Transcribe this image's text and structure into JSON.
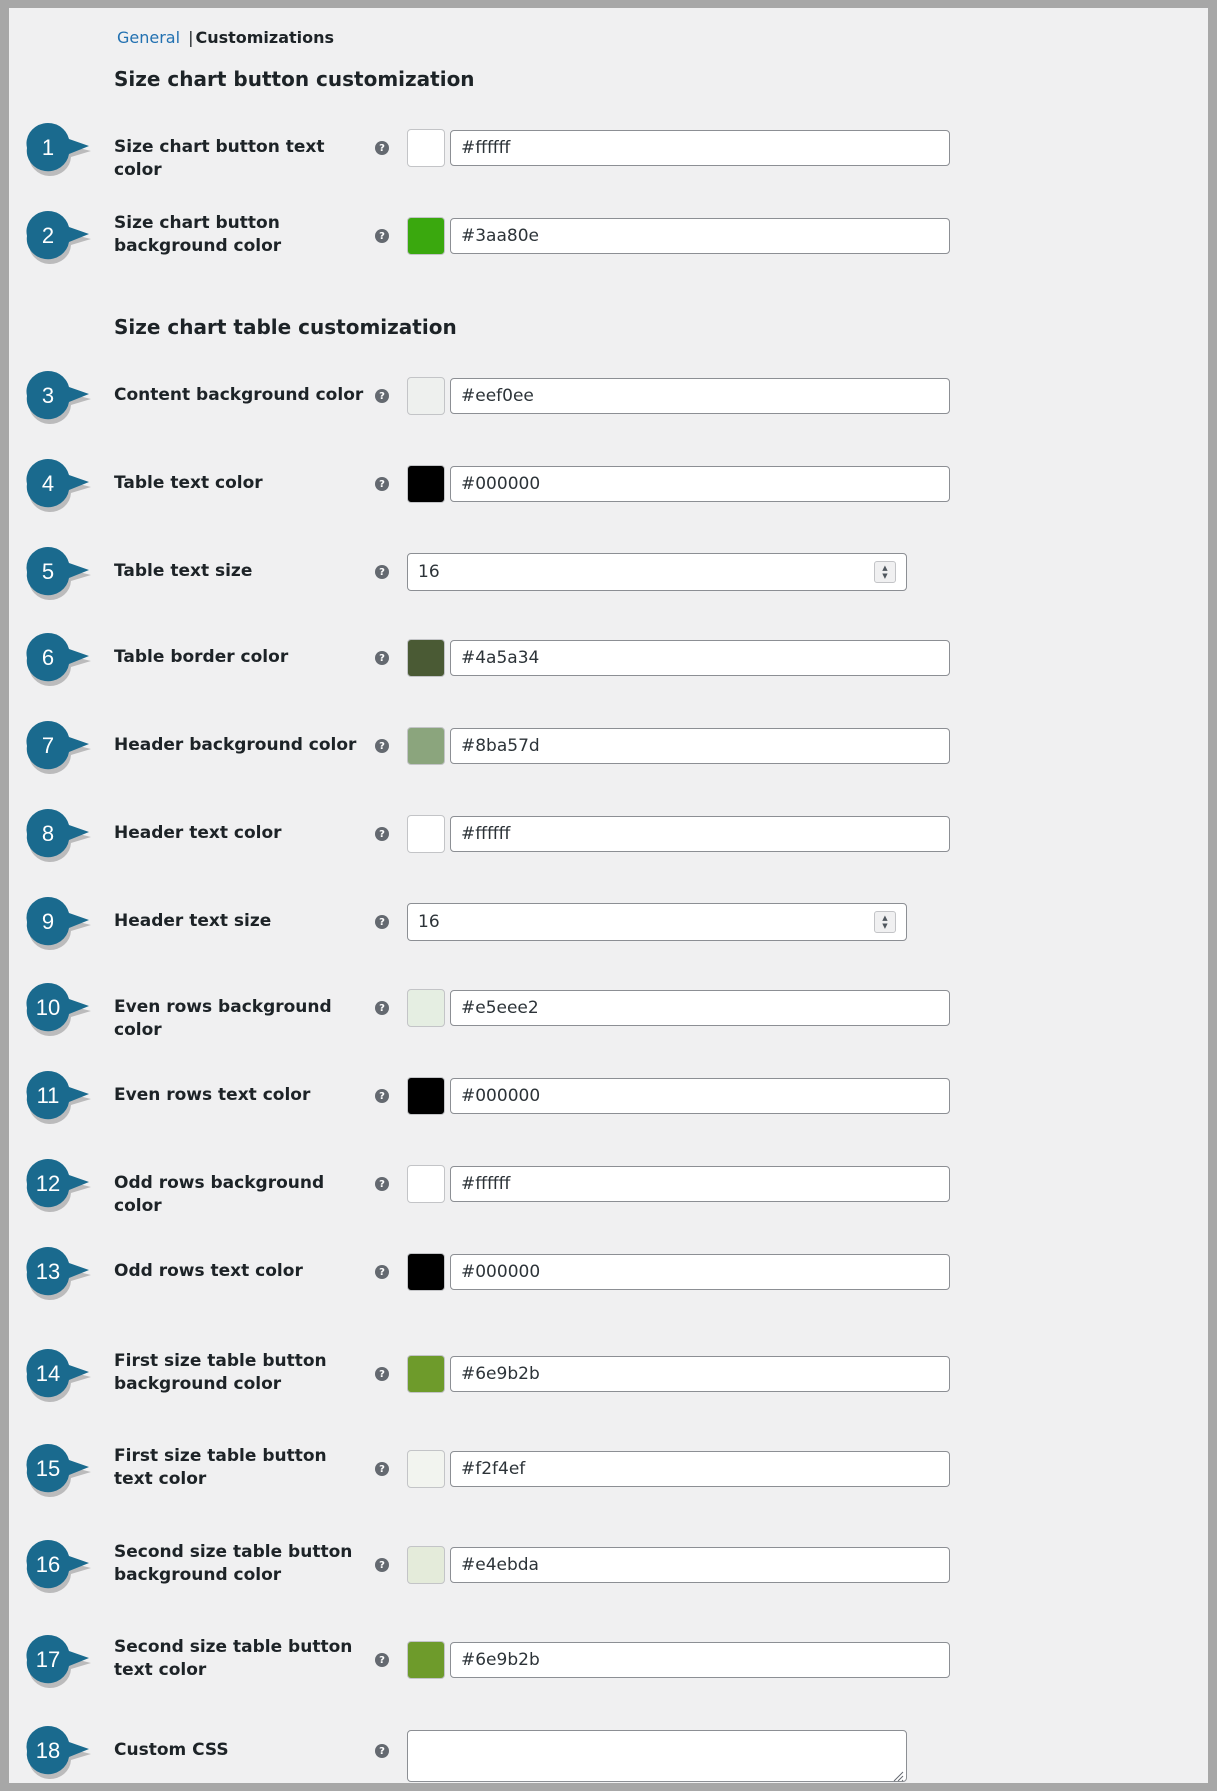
{
  "tabs": {
    "general": "General",
    "separator": "|",
    "customizations": "Customizations"
  },
  "sections": {
    "button": "Size chart button customization",
    "table": "Size chart table customization"
  },
  "colors": {
    "badge": "#1a6a8e",
    "help_icon": "#646970",
    "link": "#2271b1"
  },
  "help_icon": "?",
  "spinner": {
    "up": "▲",
    "down": "▼"
  },
  "rows": [
    {
      "num": "1",
      "label": "Size chart button text color",
      "type": "color",
      "value": "#ffffff",
      "swatch": "#ffffff"
    },
    {
      "num": "2",
      "label": "Size chart button background color",
      "type": "color",
      "value": "#3aa80e",
      "swatch": "#3aa80e"
    },
    {
      "num": "3",
      "label": "Content background color",
      "type": "color",
      "value": "#eef0ee",
      "swatch": "#eef0ee"
    },
    {
      "num": "4",
      "label": "Table text color",
      "type": "color",
      "value": "#000000",
      "swatch": "#000000"
    },
    {
      "num": "5",
      "label": "Table text size",
      "type": "number",
      "value": "16"
    },
    {
      "num": "6",
      "label": "Table border color",
      "type": "color",
      "value": "#4a5a34",
      "swatch": "#4a5a34"
    },
    {
      "num": "7",
      "label": "Header background color",
      "type": "color",
      "value": "#8ba57d",
      "swatch": "#8ba57d"
    },
    {
      "num": "8",
      "label": "Header text color",
      "type": "color",
      "value": "#ffffff",
      "swatch": "#ffffff"
    },
    {
      "num": "9",
      "label": "Header text size",
      "type": "number",
      "value": "16"
    },
    {
      "num": "10",
      "label": "Even rows background color",
      "type": "color",
      "value": "#e5eee2",
      "swatch": "#e5eee2"
    },
    {
      "num": "11",
      "label": "Even rows text color",
      "type": "color",
      "value": "#000000",
      "swatch": "#000000"
    },
    {
      "num": "12",
      "label": "Odd rows background color",
      "type": "color",
      "value": "#ffffff",
      "swatch": "#ffffff"
    },
    {
      "num": "13",
      "label": "Odd rows text color",
      "type": "color",
      "value": "#000000",
      "swatch": "#000000"
    },
    {
      "num": "14",
      "label": "First size table button background color",
      "type": "color",
      "value": "#6e9b2b",
      "swatch": "#6e9b2b"
    },
    {
      "num": "15",
      "label": "First size table button text color",
      "type": "color",
      "value": "#f2f4ef",
      "swatch": "#f2f4ef"
    },
    {
      "num": "16",
      "label": "Second size table button background color",
      "type": "color",
      "value": "#e4ebda",
      "swatch": "#e4ebda"
    },
    {
      "num": "17",
      "label": "Second size table button text color",
      "type": "color",
      "value": "#6e9b2b",
      "swatch": "#6e9b2b"
    },
    {
      "num": "18",
      "label": "Custom CSS",
      "type": "textarea",
      "value": ""
    }
  ]
}
